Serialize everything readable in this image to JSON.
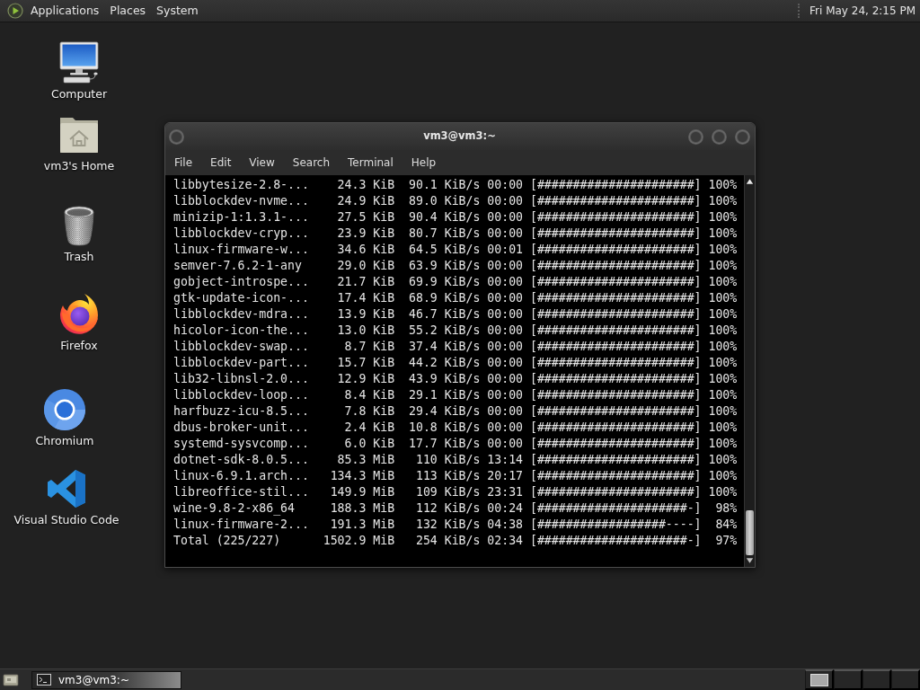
{
  "top_panel": {
    "menus": [
      "Applications",
      "Places",
      "System"
    ],
    "clock": "Fri May 24, 2:15 PM"
  },
  "desktop_icons": [
    {
      "label": "Computer",
      "kind": "computer"
    },
    {
      "label": "vm3's Home",
      "kind": "home"
    },
    {
      "label": "Trash",
      "kind": "trash"
    },
    {
      "label": "Firefox",
      "kind": "firefox"
    },
    {
      "label": "Chromium",
      "kind": "chromium"
    },
    {
      "label": "Visual Studio Code",
      "kind": "vscode"
    }
  ],
  "terminal": {
    "title": "vm3@vm3:~",
    "menu": [
      "File",
      "Edit",
      "View",
      "Search",
      "Terminal",
      "Help"
    ],
    "lines": [
      [
        "libbytesize-2.8-...",
        "24.3 KiB",
        "90.1 KiB/s",
        "00:00",
        "[######################]",
        "100%"
      ],
      [
        "libblockdev-nvme...",
        "24.9 KiB",
        "89.0 KiB/s",
        "00:00",
        "[######################]",
        "100%"
      ],
      [
        "minizip-1:1.3.1-...",
        "27.5 KiB",
        "90.4 KiB/s",
        "00:00",
        "[######################]",
        "100%"
      ],
      [
        "libblockdev-cryp...",
        "23.9 KiB",
        "80.7 KiB/s",
        "00:00",
        "[######################]",
        "100%"
      ],
      [
        "linux-firmware-w...",
        "34.6 KiB",
        "64.5 KiB/s",
        "00:01",
        "[######################]",
        "100%"
      ],
      [
        "semver-7.6.2-1-any",
        "29.0 KiB",
        "63.9 KiB/s",
        "00:00",
        "[######################]",
        "100%"
      ],
      [
        "gobject-introspe...",
        "21.7 KiB",
        "69.9 KiB/s",
        "00:00",
        "[######################]",
        "100%"
      ],
      [
        "gtk-update-icon-...",
        "17.4 KiB",
        "68.9 KiB/s",
        "00:00",
        "[######################]",
        "100%"
      ],
      [
        "libblockdev-mdra...",
        "13.9 KiB",
        "46.7 KiB/s",
        "00:00",
        "[######################]",
        "100%"
      ],
      [
        "hicolor-icon-the...",
        "13.0 KiB",
        "55.2 KiB/s",
        "00:00",
        "[######################]",
        "100%"
      ],
      [
        "libblockdev-swap...",
        "8.7 KiB",
        "37.4 KiB/s",
        "00:00",
        "[######################]",
        "100%"
      ],
      [
        "libblockdev-part...",
        "15.7 KiB",
        "44.2 KiB/s",
        "00:00",
        "[######################]",
        "100%"
      ],
      [
        "lib32-libnsl-2.0...",
        "12.9 KiB",
        "43.9 KiB/s",
        "00:00",
        "[######################]",
        "100%"
      ],
      [
        "libblockdev-loop...",
        "8.4 KiB",
        "29.1 KiB/s",
        "00:00",
        "[######################]",
        "100%"
      ],
      [
        "harfbuzz-icu-8.5...",
        "7.8 KiB",
        "29.4 KiB/s",
        "00:00",
        "[######################]",
        "100%"
      ],
      [
        "dbus-broker-unit...",
        "2.4 KiB",
        "10.8 KiB/s",
        "00:00",
        "[######################]",
        "100%"
      ],
      [
        "systemd-sysvcomp...",
        "6.0 KiB",
        "17.7 KiB/s",
        "00:00",
        "[######################]",
        "100%"
      ],
      [
        "dotnet-sdk-8.0.5...",
        "85.3 MiB",
        "110 KiB/s",
        "13:14",
        "[######################]",
        "100%"
      ],
      [
        "linux-6.9.1.arch...",
        "134.3 MiB",
        "113 KiB/s",
        "20:17",
        "[######################]",
        "100%"
      ],
      [
        "libreoffice-stil...",
        "149.9 MiB",
        "109 KiB/s",
        "23:31",
        "[######################]",
        "100%"
      ],
      [
        "wine-9.8-2-x86_64",
        "188.3 MiB",
        "112 KiB/s",
        "00:24",
        "[#####################-]",
        "98%"
      ],
      [
        "linux-firmware-2...",
        "191.3 MiB",
        "132 KiB/s",
        "04:38",
        "[##################----]",
        "84%"
      ],
      [
        "Total (225/227)",
        "1502.9 MiB",
        "254 KiB/s",
        "02:34",
        "[#####################-]",
        "97%"
      ]
    ]
  },
  "taskbar": {
    "windows": [
      {
        "title": "vm3@vm3:~",
        "selected": true
      }
    ]
  }
}
